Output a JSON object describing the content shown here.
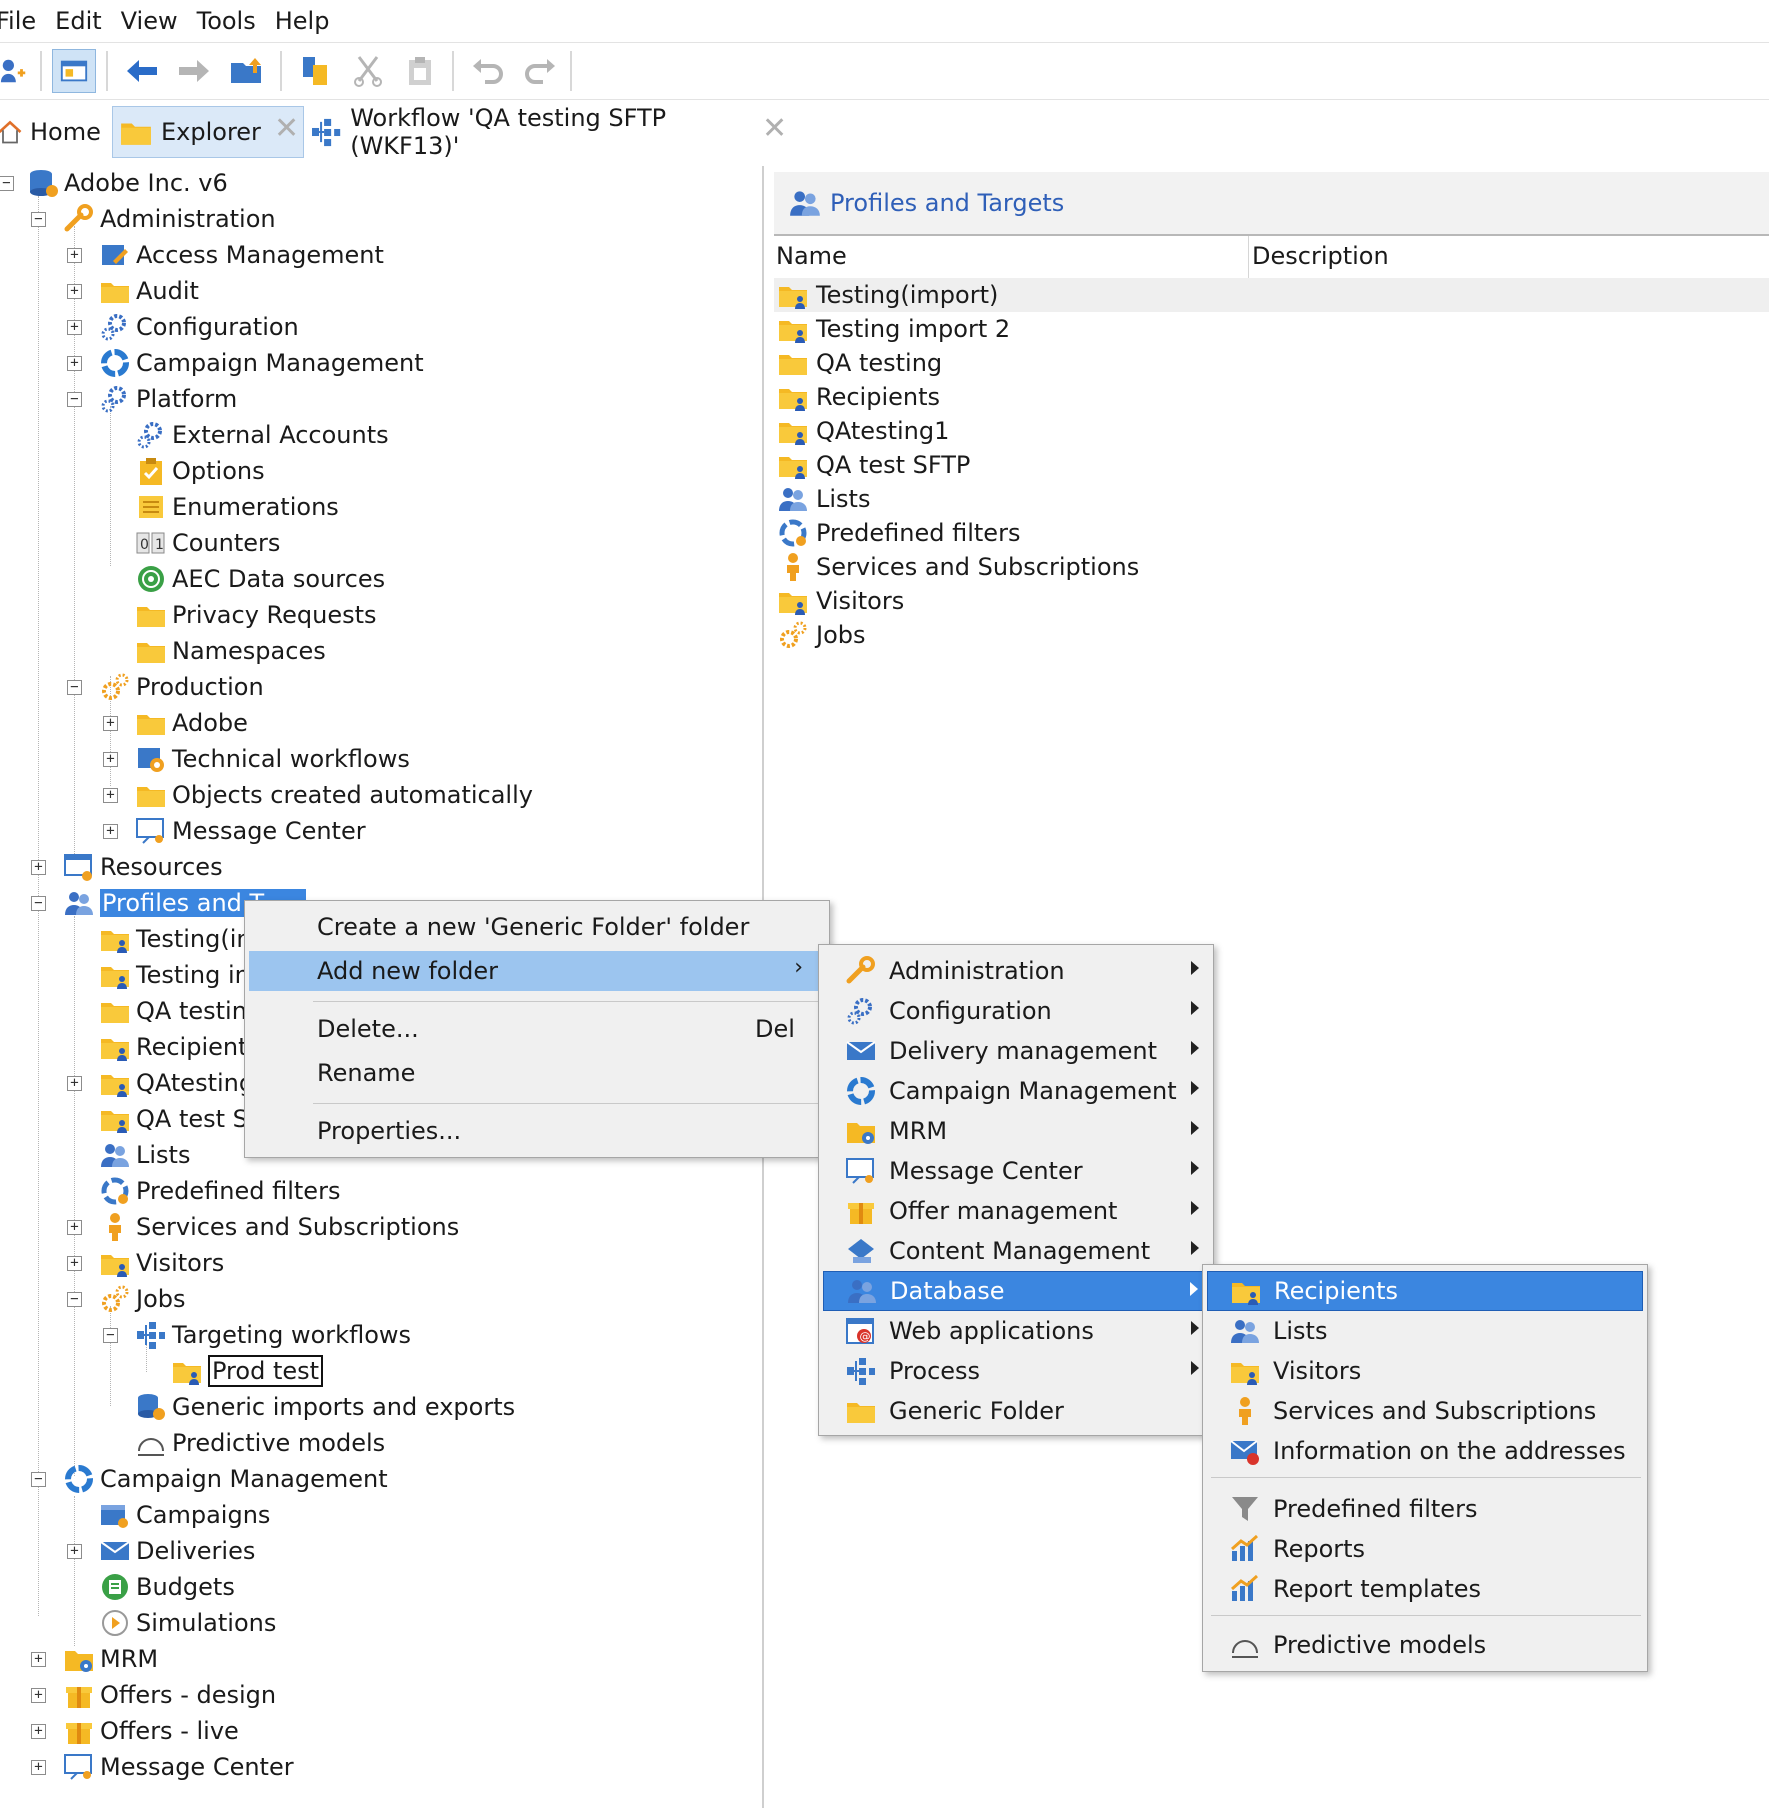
{
  "menubar": [
    "File",
    "Edit",
    "View",
    "Tools",
    "Help"
  ],
  "toolbar_icons": [
    "new-icon",
    "explorer-icon",
    "back-icon",
    "forward-icon",
    "up-folder-icon",
    "copy-icon",
    "cut-icon",
    "paste-icon",
    "undo-icon",
    "redo-icon"
  ],
  "tabs": [
    {
      "label": "Home",
      "icon": "home-icon"
    },
    {
      "label": "Explorer",
      "icon": "folder-icon"
    },
    {
      "label": "Workflow 'QA testing SFTP (WKF13)'",
      "icon": "workflow-icon"
    }
  ],
  "tree": {
    "root": "Adobe Inc. v6",
    "administration": "Administration",
    "access_management": "Access Management",
    "audit": "Audit",
    "configuration": "Configuration",
    "campaign_management_admin": "Campaign Management",
    "platform": "Platform",
    "external_accounts": "External Accounts",
    "options": "Options",
    "enumerations": "Enumerations",
    "counters": "Counters",
    "aec_data_sources": "AEC Data sources",
    "privacy_requests": "Privacy Requests",
    "namespaces": "Namespaces",
    "production": "Production",
    "adobe": "Adobe",
    "technical_workflows": "Technical workflows",
    "objects_created": "Objects created automatically",
    "message_center_prod": "Message Center",
    "resources": "Resources",
    "profiles_and_targets": "Profiles and T",
    "testing_import": "Testing(im",
    "testing_import2": "Testing im",
    "qa_testing": "QA testing",
    "recipients": "Recipients",
    "qatesting1": "QAtesting",
    "qa_test_sftp": "QA test SF",
    "lists": "Lists",
    "predefined_filters": "Predefined filters",
    "services_subscriptions": "Services and Subscriptions",
    "visitors": "Visitors",
    "jobs": "Jobs",
    "targeting_workflows": "Targeting workflows",
    "prod_test": "Prod test",
    "generic_imports": "Generic imports and exports",
    "predictive_models": "Predictive models",
    "campaign_management": "Campaign Management",
    "campaigns": "Campaigns",
    "deliveries": "Deliveries",
    "budgets": "Budgets",
    "simulations": "Simulations",
    "mrm": "MRM",
    "offers_design": "Offers - design",
    "offers_live": "Offers - live",
    "message_center": "Message Center"
  },
  "right_panel": {
    "title": "Profiles and Targets",
    "columns": [
      "Name",
      "Description"
    ],
    "rows": [
      "Testing(import)",
      "Testing import 2",
      "QA testing",
      "Recipients",
      "QAtesting1",
      "QA test SFTP",
      "Lists",
      "Predefined filters",
      "Services and Subscriptions",
      "Visitors",
      "Jobs"
    ]
  },
  "context_menu": {
    "create_generic": "Create a new 'Generic Folder' folder",
    "add_new_folder": "Add new folder",
    "delete": "Delete...",
    "delete_shortcut": "Del",
    "rename": "Rename",
    "properties": "Properties..."
  },
  "submenu1": [
    "Administration",
    "Configuration",
    "Delivery management",
    "Campaign Management",
    "MRM",
    "Message Center",
    "Offer management",
    "Content Management",
    "Database",
    "Web applications",
    "Process",
    "Generic Folder"
  ],
  "submenu2": [
    "Recipients",
    "Lists",
    "Visitors",
    "Services and Subscriptions",
    "Information on the addresses",
    "Predefined filters",
    "Reports",
    "Report templates",
    "Predictive models"
  ],
  "colors": {
    "accent": "#3b86e0",
    "highlight": "#9cc5ef",
    "folder": "#f5b924",
    "link": "#2f5fb8"
  }
}
